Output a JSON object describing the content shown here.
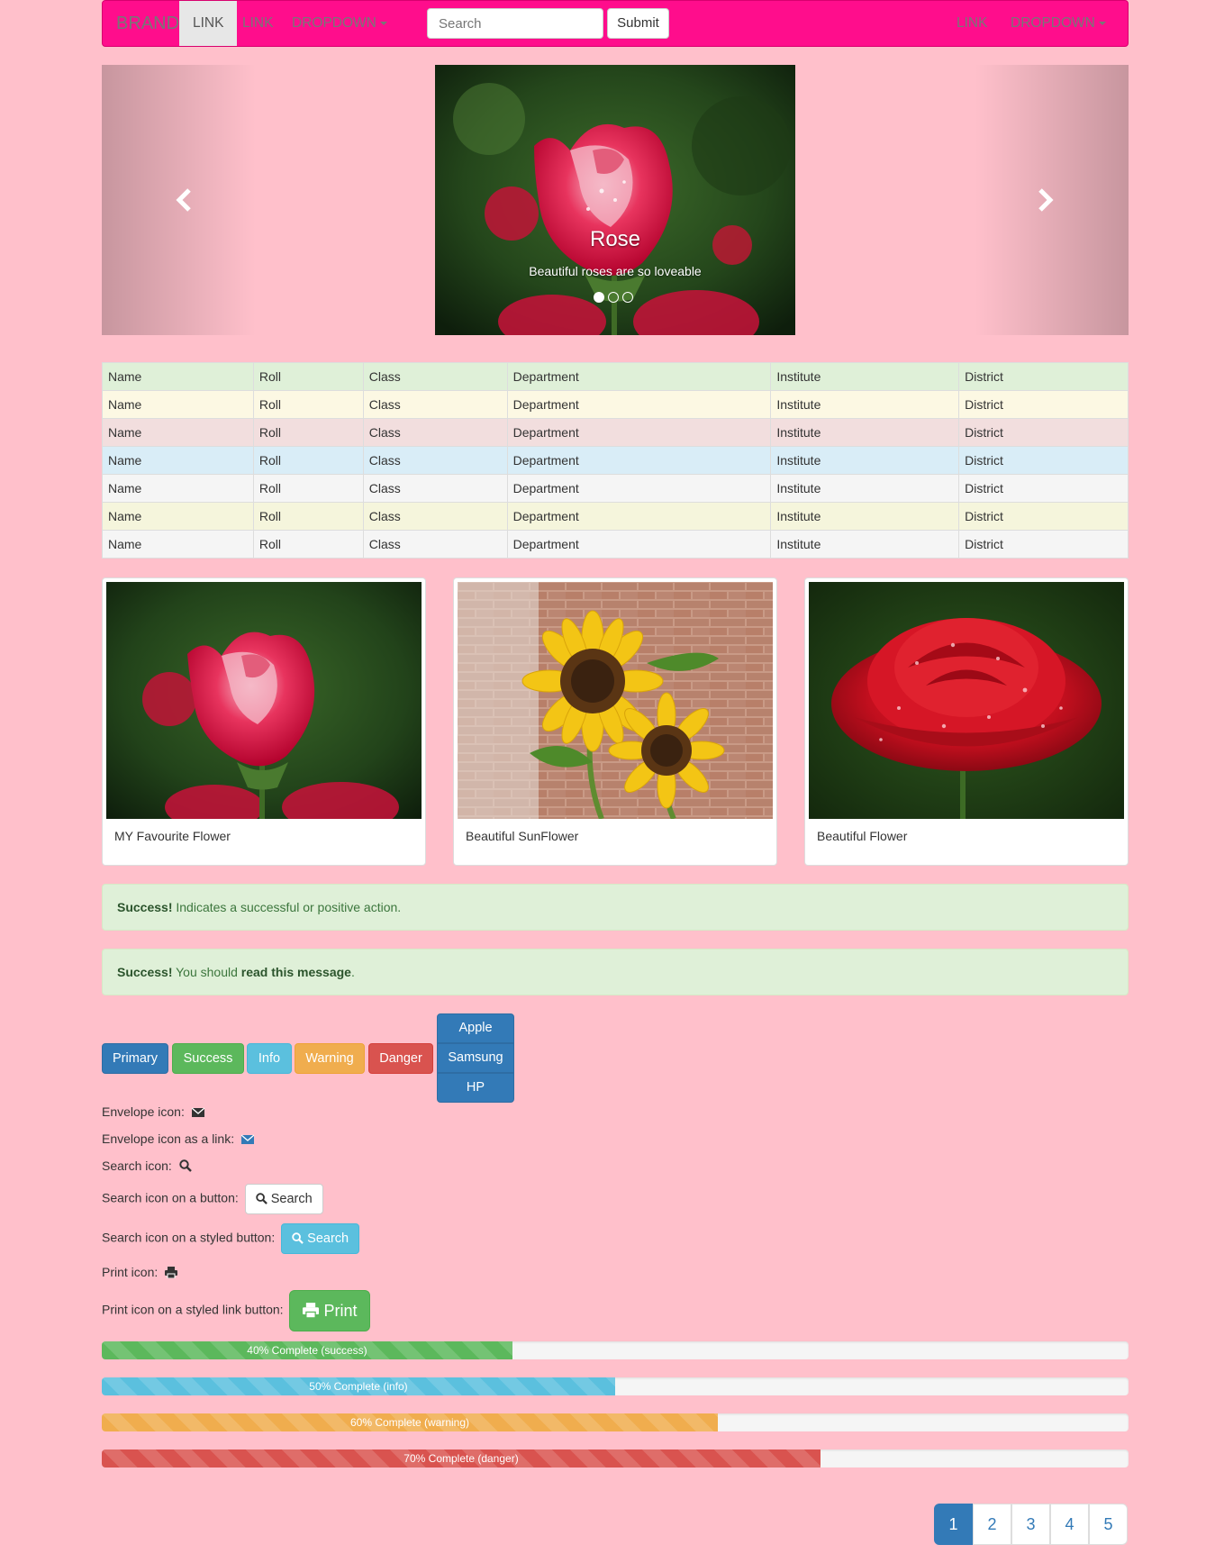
{
  "navbar": {
    "brand": "BRAND",
    "left_links": [
      {
        "label": "LINK",
        "active": true
      },
      {
        "label": "LINK",
        "active": false
      }
    ],
    "left_dropdown": "DROPDOWN",
    "search_placeholder": "Search",
    "submit_label": "Submit",
    "right_link": "LINK",
    "right_dropdown": "DROPDOWN"
  },
  "carousel": {
    "caption_title": "Rose",
    "caption_text": "Beautiful roses are so loveable",
    "slide_count": 3,
    "active_slide": 1
  },
  "table": {
    "rows": [
      [
        "Name",
        "Roll",
        "Class",
        "Department",
        "Institute",
        "District"
      ],
      [
        "Name",
        "Roll",
        "Class",
        "Department",
        "Institute",
        "District"
      ],
      [
        "Name",
        "Roll",
        "Class",
        "Department",
        "Institute",
        "District"
      ],
      [
        "Name",
        "Roll",
        "Class",
        "Department",
        "Institute",
        "District"
      ],
      [
        "Name",
        "Roll",
        "Class",
        "Department",
        "Institute",
        "District"
      ],
      [
        "Name",
        "Roll",
        "Class",
        "Department",
        "Institute",
        "District"
      ],
      [
        "Name",
        "Roll",
        "Class",
        "Department",
        "Institute",
        "District"
      ]
    ]
  },
  "thumbnails": [
    {
      "caption": "MY Favourite Flower"
    },
    {
      "caption": "Beautiful SunFlower"
    },
    {
      "caption": "Beautiful Flower"
    }
  ],
  "alerts": {
    "first": {
      "strong": "Success!",
      "text": " Indicates a successful or positive action."
    },
    "second": {
      "strong": "Success!",
      "text_before": " You should ",
      "link": "read this message",
      "text_after": "."
    }
  },
  "buttons": {
    "primary": "Primary",
    "success": "Success",
    "info": "Info",
    "warning": "Warning",
    "danger": "Danger",
    "group": [
      "Apple",
      "Samsung",
      "HP"
    ]
  },
  "icons": {
    "envelope": "Envelope icon:",
    "envelope_link": "Envelope icon as a link:",
    "search": "Search icon:",
    "search_button": "Search icon on a button:",
    "search_button_label": "Search",
    "search_styled": "Search icon on a styled button:",
    "search_styled_label": "Search",
    "print": "Print icon:",
    "print_link": "Print icon on a styled link button:",
    "print_label": "Print"
  },
  "progress": [
    {
      "label": "40% Complete (success)",
      "value": 40,
      "type": "success"
    },
    {
      "label": "50% Complete (info)",
      "value": 50,
      "type": "info"
    },
    {
      "label": "60% Complete (warning)",
      "value": 60,
      "type": "warning"
    },
    {
      "label": "70% Complete (danger)",
      "value": 70,
      "type": "danger"
    }
  ],
  "pagination": {
    "pages": [
      "1",
      "2",
      "3",
      "4",
      "5"
    ],
    "active": "1"
  },
  "colors": {
    "page_background": "#ffc0cb",
    "navbar_background": "#ff0d8c",
    "primary": "#337ab7",
    "success": "#5cb85c",
    "info": "#5bc0de",
    "warning": "#f0ad4e",
    "danger": "#d9534f"
  }
}
